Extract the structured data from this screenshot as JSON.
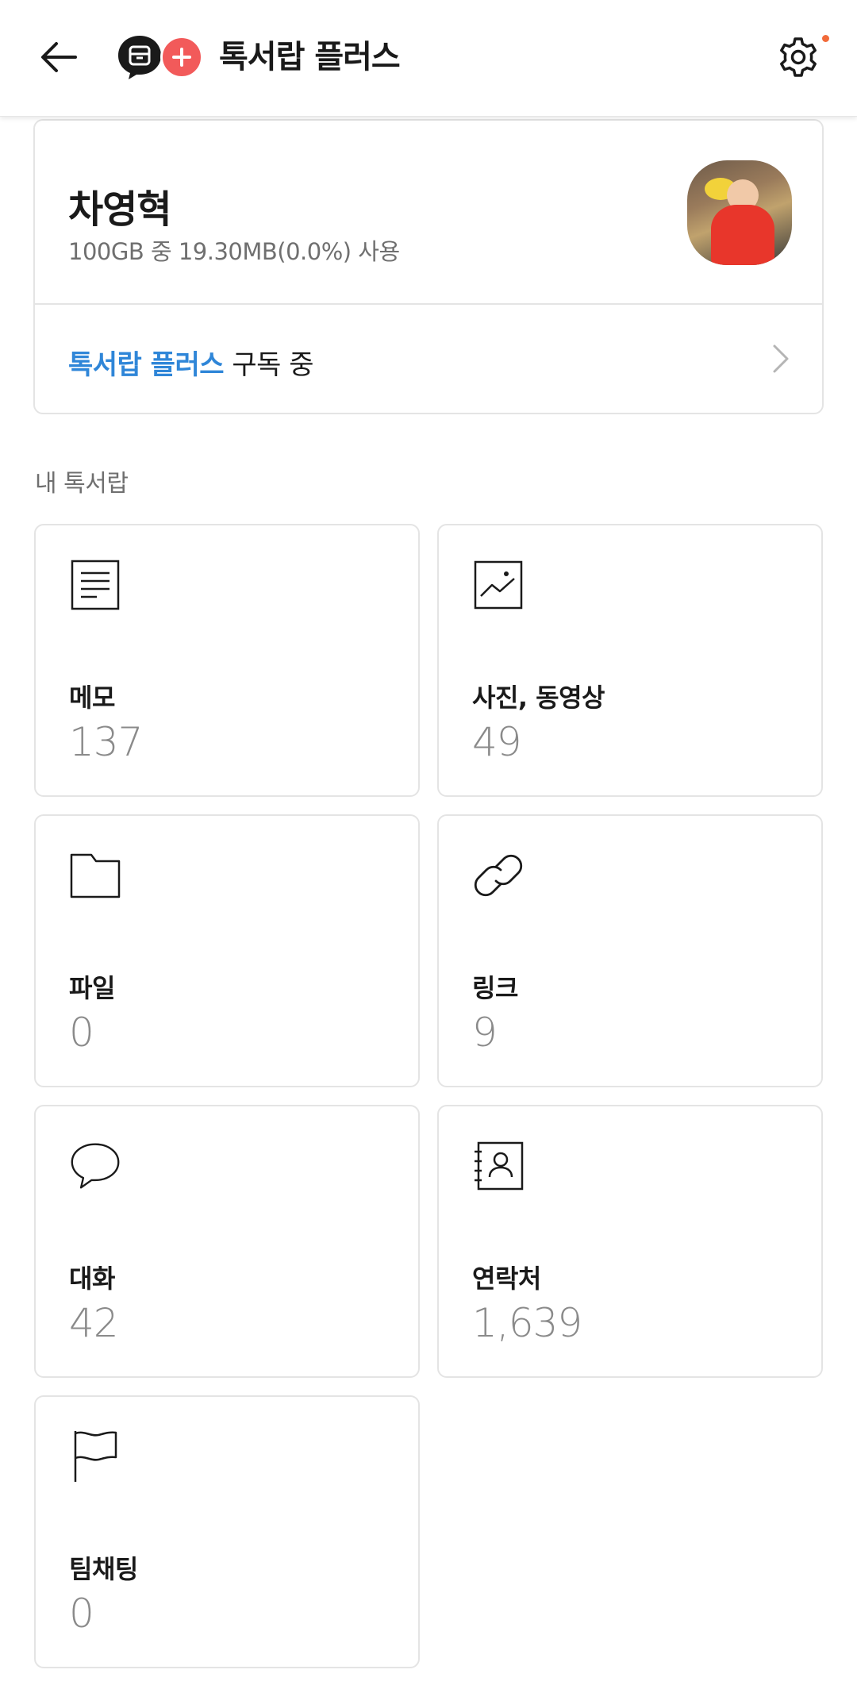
{
  "header": {
    "title": "톡서랍 플러스",
    "back_icon": "arrow-left-icon",
    "settings_icon": "gear-icon",
    "settings_badge_color": "#f26b3a",
    "logo_plus_color": "#f25a5a"
  },
  "profile": {
    "name": "차영혁",
    "usage": "100GB 중 19.30MB(0.0%) 사용",
    "subscription_accent": "톡서랍 플러스",
    "subscription_rest": " 구독 중",
    "accent_color": "#2f86d8"
  },
  "section": {
    "label": "내 톡서랍"
  },
  "tiles": [
    {
      "label": "메모",
      "count": "137",
      "icon": "memo-icon"
    },
    {
      "label": "사진, 동영상",
      "count": "49",
      "icon": "photo-icon"
    },
    {
      "label": "파일",
      "count": "0",
      "icon": "folder-icon"
    },
    {
      "label": "링크",
      "count": "9",
      "icon": "link-icon"
    },
    {
      "label": "대화",
      "count": "42",
      "icon": "chat-bubble-icon"
    },
    {
      "label": "연락처",
      "count": "1,639",
      "icon": "contact-book-icon"
    },
    {
      "label": "팀채팅",
      "count": "0",
      "icon": "flag-icon"
    }
  ]
}
